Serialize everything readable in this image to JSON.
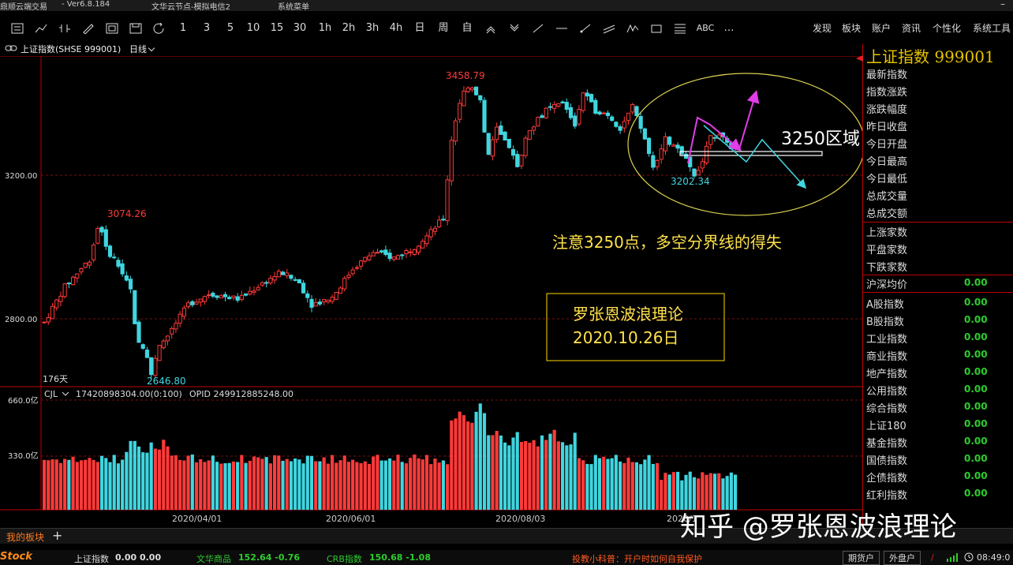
{
  "titlebar": {
    "app_name": "鼎顺云端交易",
    "version": "- Ver6.8.184",
    "server": "文华云节点-模拟电信2",
    "menu": "系统菜单",
    "minimize": "–"
  },
  "toolbar": {
    "periods": [
      "1",
      "3",
      "5",
      "10",
      "15",
      "30",
      "1h",
      "2h",
      "3h",
      "4h",
      "日",
      "周",
      "自"
    ],
    "abc_label": "ABC",
    "more_label": "…",
    "right_menu": [
      "发现",
      "板块",
      "账户",
      "资讯",
      "个性化",
      "系统工具"
    ]
  },
  "subheader": {
    "symbol": "上证指数(SHSE 999001)",
    "period": "日线"
  },
  "chart": {
    "price_ticks": [
      "3200.00",
      "2800.00"
    ],
    "volume_ticks": [
      "660.0亿",
      "330.0亿"
    ],
    "date_labels": [
      "2020/04/01",
      "2020/06/01",
      "2020/08/03",
      "2020/1"
    ],
    "high_label": "3458.79",
    "mid_high_label": "3074.26",
    "low_label": "2646.80",
    "recent_low_label": "3202.34",
    "days_label": "176天",
    "volume_header": "CJL",
    "volume_value": "17420898304.00(0:100)",
    "opid_label": "OPID 249912885248.00",
    "zone_label": "3250区域",
    "note_text": "注意3250点，多空分界线的得失",
    "box_line1": "罗张恩波浪理论",
    "box_line2": "2020.10.26日",
    "colors": {
      "up": "#ff3a3a",
      "down": "#3fd6e0",
      "note": "#ffe24a",
      "box": "#ffd700",
      "arrow_pink": "#e23ce8",
      "ellipse": "#d8d050"
    }
  },
  "chart_data": {
    "type": "candlestick",
    "title": "上证指数(SHSE 999001)",
    "period": "日线",
    "annotated_high": 3458.79,
    "annotated_mid_high": 3074.26,
    "annotated_low": 2646.8,
    "annotated_recent_low": 3202.34,
    "key_level": 3250,
    "price_axis_ticks": [
      3200,
      2800
    ],
    "volume_axis_ticks_yi": [
      660,
      330
    ],
    "x_labels": [
      "2020/04/01",
      "2020/06/01",
      "2020/08/03",
      "2020/1"
    ],
    "volume_value": 17420898304.0,
    "opid_value": 249912885248.0
  },
  "panel": {
    "title": "上证指数",
    "code": "999001",
    "rows1": [
      "最新指数",
      "指数涨跌",
      "涨跌幅度",
      "昨日收盘",
      "今日开盘",
      "今日最高",
      "今日最低",
      "总成交量",
      "总成交额"
    ],
    "rows2": [
      "上涨家数",
      "平盘家数",
      "下跌家数"
    ],
    "row3": {
      "label": "沪深均价",
      "value": "0.00"
    },
    "rows4": [
      {
        "label": "A股指数",
        "value": "0.00"
      },
      {
        "label": "B股指数",
        "value": "0.00"
      },
      {
        "label": "工业指数",
        "value": "0.00"
      },
      {
        "label": "商业指数",
        "value": "0.00"
      },
      {
        "label": "地产指数",
        "value": "0.00"
      },
      {
        "label": "公用指数",
        "value": "0.00"
      },
      {
        "label": "综合指数",
        "value": "0.00"
      },
      {
        "label": "上证180",
        "value": "0.00"
      },
      {
        "label": "基金指数",
        "value": "0.00"
      },
      {
        "label": "国债指数",
        "value": "0.00"
      },
      {
        "label": "企债指数",
        "value": "0.00"
      },
      {
        "label": "红利指数",
        "value": "0.00"
      }
    ]
  },
  "tabbar": {
    "tab": "我的板块",
    "plus": "+"
  },
  "statusbar": {
    "logo": "Stock",
    "sh_label": "上证指数",
    "sh_values": "0.00  0.00",
    "wh_label": "文华商品",
    "wh_values": "152.64  -0.76",
    "crb_label": "CRB指数",
    "crb_values": "150.68  -1.08",
    "tip": "投教小科普：开户时如何自我保护",
    "btn1": "期货户",
    "btn2": "外盘户",
    "time": "08:49:0"
  },
  "watermark": "知乎 @罗张恩波浪理论"
}
